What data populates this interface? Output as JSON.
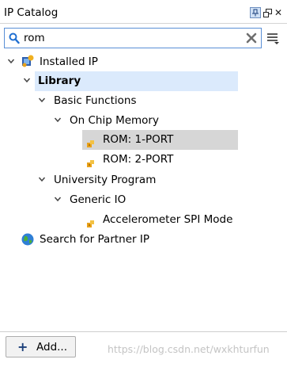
{
  "panel": {
    "title": "IP Catalog"
  },
  "search": {
    "value": "rom"
  },
  "tree": {
    "installed_ip": "Installed IP",
    "library": "Library",
    "basic_functions": "Basic Functions",
    "on_chip_memory": "On Chip Memory",
    "rom_1_port": "ROM: 1-PORT",
    "rom_2_port": "ROM: 2-PORT",
    "university_program": "University Program",
    "generic_io": "Generic IO",
    "accelerometer_spi": "Accelerometer SPI Mode",
    "search_partner_ip": "Search for Partner IP"
  },
  "footer": {
    "add_label": "Add...",
    "watermark": "https://blog.csdn.net/wxkhturfun"
  },
  "colors": {
    "selection_library": "#dbeafc",
    "selection_item": "#d6d6d6",
    "accent": "#5a8fd6"
  }
}
